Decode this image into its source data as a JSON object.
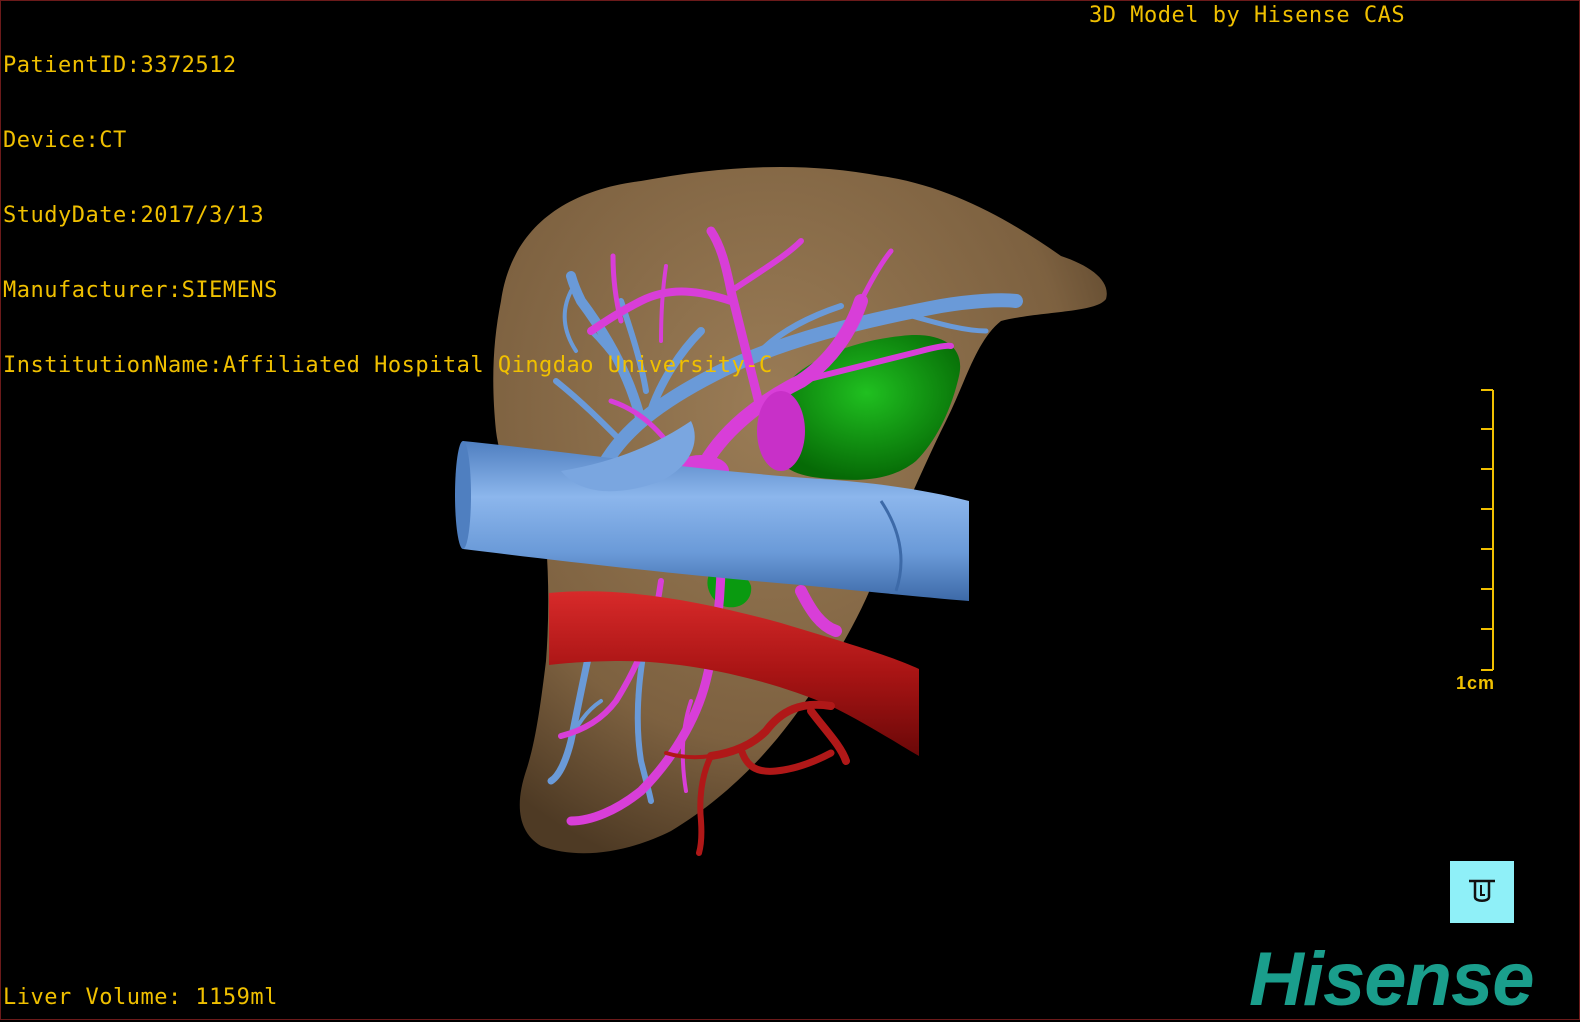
{
  "patient_info": {
    "patient_id": "PatientID:3372512",
    "device": "Device:CT",
    "study_date": "StudyDate:2017/3/13",
    "manufacturer": "Manufacturer:SIEMENS",
    "institution": "InstitutionName:Affiliated Hospital Qingdao University-C"
  },
  "credit": "3D Model by Hisense CAS",
  "volume": "Liver Volume: 1159ml",
  "scale": {
    "label": "1cm"
  },
  "brand": "Hisense",
  "colors": {
    "overlay_text": "#f0c000",
    "liver": "#8a6c48",
    "portal_vein": "#d83ed8",
    "hepatic_vein": "#6a9ad8",
    "ivc": "#6a9ad8",
    "artery": "#b01818",
    "tumor": "#0a9a10",
    "brand": "#1a9e8c",
    "tool_button": "#8ff0f8"
  },
  "icons": {
    "tool_button": "cup-icon"
  }
}
